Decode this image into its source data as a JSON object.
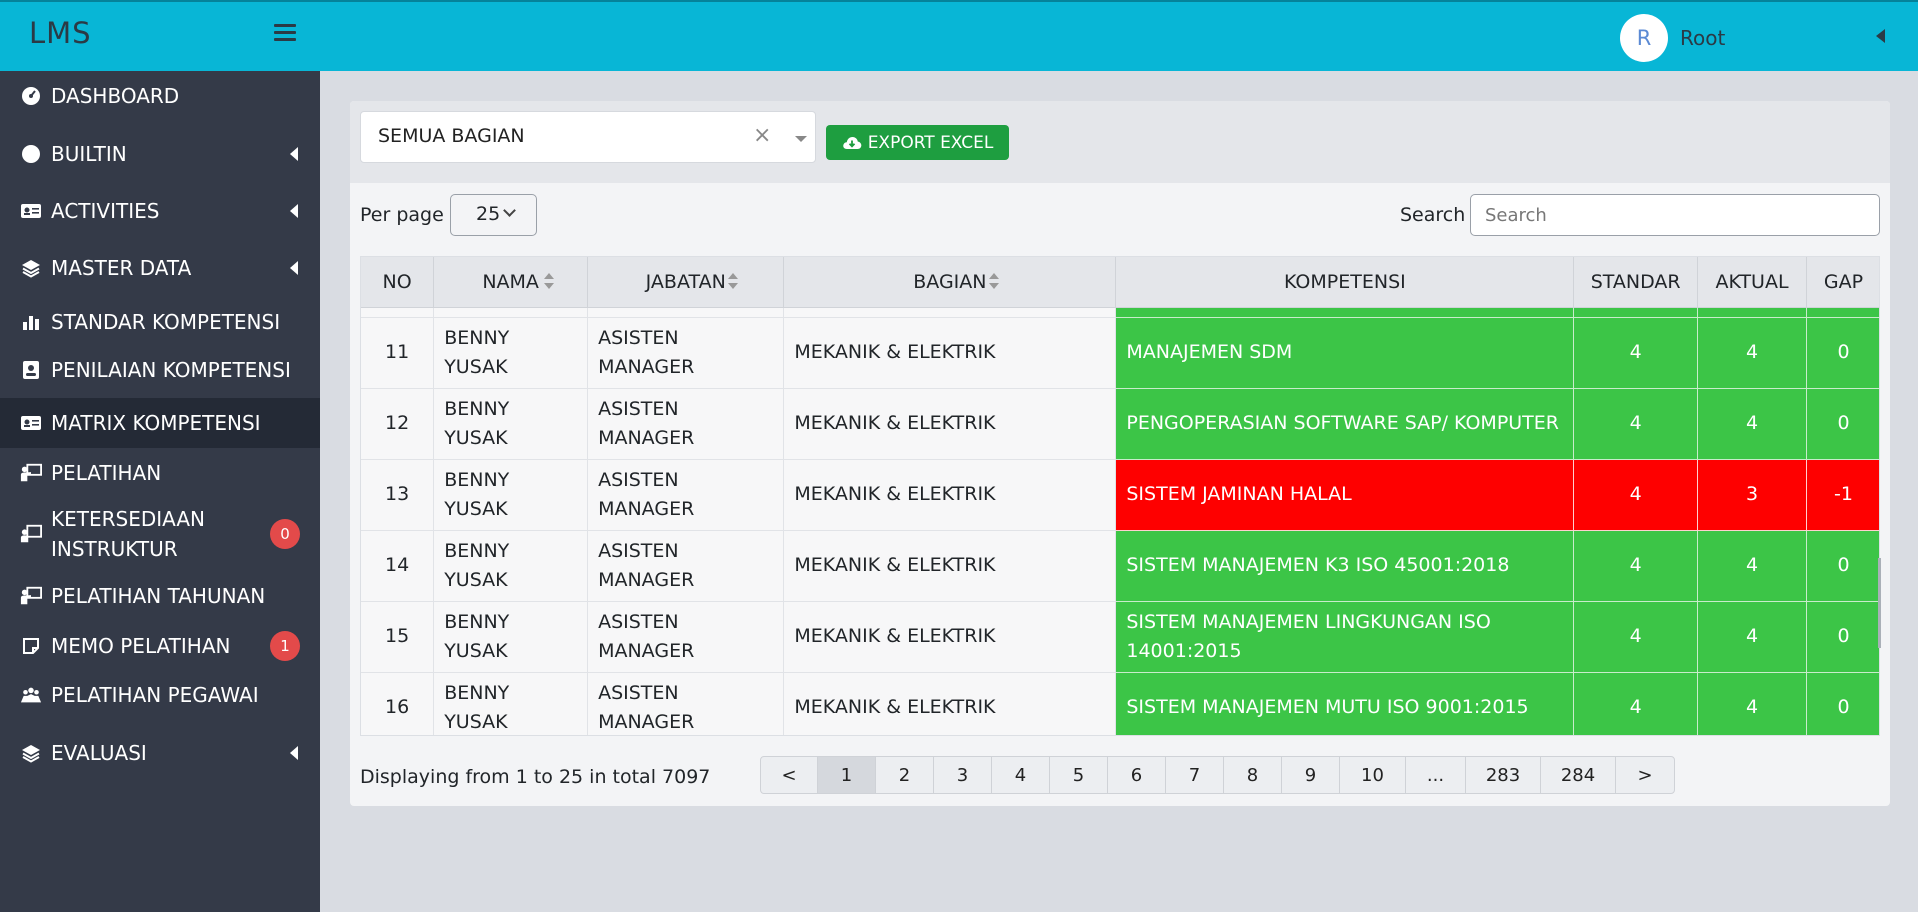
{
  "app": {
    "brand": "LMS",
    "user_initial": "R",
    "user_name": "Root"
  },
  "sidebar": {
    "items": [
      {
        "label": "DASHBOARD",
        "icon": "gauge-icon",
        "arrow": false,
        "badge": ""
      },
      {
        "label": "BUILTIN",
        "icon": "circle-icon",
        "arrow": true,
        "badge": ""
      },
      {
        "label": "ACTIVITIES",
        "icon": "id-card-icon",
        "arrow": true,
        "badge": ""
      },
      {
        "label": "MASTER DATA",
        "icon": "layers-icon",
        "arrow": true,
        "badge": ""
      },
      {
        "label": "STANDAR KOMPETENSI",
        "icon": "bar-chart-icon",
        "arrow": false,
        "badge": ""
      },
      {
        "label": "PENILAIAN KOMPETENSI",
        "icon": "user-card-icon",
        "arrow": false,
        "badge": ""
      },
      {
        "label": "MATRIX KOMPETENSI",
        "icon": "id-card-icon",
        "arrow": false,
        "badge": "",
        "active": true
      },
      {
        "label": "PELATIHAN",
        "icon": "teacher-icon",
        "arrow": false,
        "badge": ""
      },
      {
        "label": "KETERSEDIAAN INSTRUKTUR",
        "icon": "chalkboard-user-icon",
        "arrow": false,
        "badge": "0"
      },
      {
        "label": "PELATIHAN TAHUNAN",
        "icon": "teacher-icon",
        "arrow": false,
        "badge": ""
      },
      {
        "label": "MEMO PELATIHAN",
        "icon": "note-icon",
        "arrow": false,
        "badge": "1"
      },
      {
        "label": "PELATIHAN PEGAWAI",
        "icon": "people-group-icon",
        "arrow": false,
        "badge": ""
      },
      {
        "label": "EVALUASI",
        "icon": "layers-icon",
        "arrow": true,
        "badge": ""
      }
    ]
  },
  "filter": {
    "bagian_value": "SEMUA BAGIAN",
    "clear_symbol": "×",
    "export_label": "EXPORT EXCEL"
  },
  "controls": {
    "perpage_label": "Per page",
    "perpage_value": "25",
    "search_label": "Search",
    "search_placeholder": "Search"
  },
  "table": {
    "columns": [
      "NO",
      "NAMA",
      "JABATAN",
      "BAGIAN",
      "KOMPETENSI",
      "STANDAR",
      "AKTUAL",
      "GAP"
    ],
    "rows": [
      {
        "no": "11",
        "nama": "BENNY YUSAK",
        "jabatan": "ASISTEN MANAGER",
        "bagian": "MEKANIK & ELEKTRIK",
        "kompetensi": "MANAJEMEN SDM",
        "standar": "4",
        "aktual": "4",
        "gap": "0",
        "status": "green"
      },
      {
        "no": "12",
        "nama": "BENNY YUSAK",
        "jabatan": "ASISTEN MANAGER",
        "bagian": "MEKANIK & ELEKTRIK",
        "kompetensi": "PENGOPERASIAN SOFTWARE SAP/ KOMPUTER",
        "standar": "4",
        "aktual": "4",
        "gap": "0",
        "status": "green"
      },
      {
        "no": "13",
        "nama": "BENNY YUSAK",
        "jabatan": "ASISTEN MANAGER",
        "bagian": "MEKANIK & ELEKTRIK",
        "kompetensi": "SISTEM JAMINAN HALAL",
        "standar": "4",
        "aktual": "3",
        "gap": "-1",
        "status": "red"
      },
      {
        "no": "14",
        "nama": "BENNY YUSAK",
        "jabatan": "ASISTEN MANAGER",
        "bagian": "MEKANIK & ELEKTRIK",
        "kompetensi": "SISTEM MANAJEMEN K3 ISO 45001:2018",
        "standar": "4",
        "aktual": "4",
        "gap": "0",
        "status": "green"
      },
      {
        "no": "15",
        "nama": "BENNY YUSAK",
        "jabatan": "ASISTEN MANAGER",
        "bagian": "MEKANIK & ELEKTRIK",
        "kompetensi": "SISTEM MANAJEMEN LINGKUNGAN ISO 14001:2015",
        "standar": "4",
        "aktual": "4",
        "gap": "0",
        "status": "green"
      },
      {
        "no": "16",
        "nama": "BENNY YUSAK",
        "jabatan": "ASISTEN MANAGER",
        "bagian": "MEKANIK & ELEKTRIK",
        "kompetensi": "SISTEM MANAJEMEN MUTU ISO 9001:2015",
        "standar": "4",
        "aktual": "4",
        "gap": "0",
        "status": "green"
      }
    ]
  },
  "footer": {
    "display_text": "Displaying from 1 to 25 in total 7097",
    "pages": [
      "<",
      "1",
      "2",
      "3",
      "4",
      "5",
      "6",
      "7",
      "8",
      "9",
      "10",
      "...",
      "283",
      "284",
      ">"
    ],
    "current_page": "1"
  },
  "colors": {
    "topbar": "#08b6d6",
    "sidebar": "#343a48",
    "ok": "#3cc547",
    "gap": "#fe0000",
    "export": "#1e9e40",
    "badge": "#e34a4a"
  }
}
